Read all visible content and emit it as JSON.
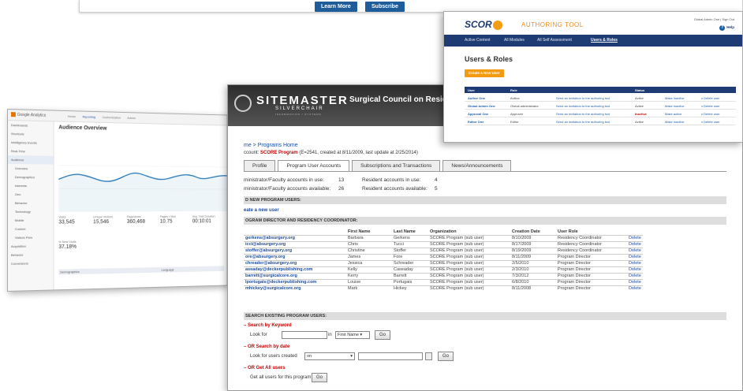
{
  "banner": {
    "learn_more": "Learn More",
    "subscribe": "Subscribe"
  },
  "ga": {
    "logo": "Google Analytics",
    "nav": [
      "Home",
      "Reporting",
      "Customization",
      "Admin"
    ],
    "sidebar": [
      "Dashboards",
      "Shortcuts",
      "Intelligence Events",
      "Real-Time",
      "Audience",
      "Overview",
      "Demographics",
      "Interests",
      "Geo",
      "Behavior",
      "Technology",
      "Mobile",
      "Custom",
      "Visitors Flow",
      "Acquisition",
      "Behavior",
      "Conversions"
    ],
    "title": "Audience Overview",
    "stats": [
      {
        "label": "Visits",
        "value": "33,545"
      },
      {
        "label": "Unique Visitors",
        "value": "15,546"
      },
      {
        "label": "Pageviews",
        "value": "360,468"
      },
      {
        "label": "Pages / Visit",
        "value": "10.75"
      },
      {
        "label": "Avg. Visit Duration",
        "value": "00:10:01"
      }
    ],
    "bounce": {
      "label": "% New Visits",
      "value": "37.18%"
    },
    "table_headers": [
      "Demographics",
      "Language"
    ]
  },
  "sitemaster": {
    "logo": "SITEMASTER",
    "sub": "SILVERCHAIR",
    "tiny": "INFORMATION / SYSTEMS",
    "title": "Surgical Council on Resid",
    "breadcrumb": "me > Programs Home",
    "account_prefix": "ccount:",
    "account_name": "SCORE Program",
    "account_rest": "(E=2541, created at 8/11/2009, last update at 2/25/2014)",
    "tabs": [
      "Profile",
      "Program User Accounts",
      "Subscriptions and Transactions",
      "News/Announcements"
    ],
    "counts": {
      "admin_label": "ministrator/Faculty accounts in use:",
      "admin_value": "13",
      "resident_label": "Resident accounts in use:",
      "resident_value": "4",
      "admin_avail_label": "ministrator/Faculty accounts available:",
      "admin_avail_value": "26",
      "resident_avail_label": "Resident accounts available:",
      "resident_avail_value": "5"
    },
    "sect_new": "D NEW PROGRAM USERS:",
    "create_link": "eate a new user",
    "sect_dir": "OGRAM DIRECTOR AND RESIDENCY COORDINATOR:",
    "columns": [
      "",
      "First Name",
      "Last Name",
      "Organization",
      "Creation Date",
      "User Role",
      ""
    ],
    "users": [
      {
        "email": "gerkens@absurgery.org",
        "first": "Barbara",
        "last": "Gerkens",
        "org": "SCORE Program (sub user)",
        "date": "8/10/2009",
        "role": "Residency Coordinator",
        "action": "Delete"
      },
      {
        "email": "icci@absurgery.org",
        "first": "Chris",
        "last": "Tucci",
        "org": "SCORE Program (sub user)",
        "date": "8/17/2009",
        "role": "Residency Coordinator",
        "action": "Delete"
      },
      {
        "email": "stoffer@absurgery.org",
        "first": "Christine",
        "last": "Stoffer",
        "org": "SCORE Program (sub user)",
        "date": "8/19/2009",
        "role": "Residency Coordinator",
        "action": "Delete"
      },
      {
        "email": "ore@absurgery.org",
        "first": "James",
        "last": "Fore",
        "org": "SCORE Program (sub user)",
        "date": "8/11/2009",
        "role": "Program Director",
        "action": "Delete"
      },
      {
        "email": "chreader@absurgery.org",
        "first": "Jessica",
        "last": "Schreader",
        "org": "SCORE Program (sub user)",
        "date": "2/5/2010",
        "role": "Program Director",
        "action": "Delete"
      },
      {
        "email": "aseaday@deckerpublishing.com",
        "first": "Kelly",
        "last": "Caseaday",
        "org": "SCORE Program (sub user)",
        "date": "2/3/2010",
        "role": "Program Director",
        "action": "Delete"
      },
      {
        "email": "barrett@surgicalcore.org",
        "first": "Kerry",
        "last": "Barrett",
        "org": "SCORE Program (sub user)",
        "date": "7/3/2012",
        "role": "Program Director",
        "action": "Delete"
      },
      {
        "email": "lportugais@deckerpublishing.com",
        "first": "Louise",
        "last": "Portugais",
        "org": "SCORE Program (sub user)",
        "date": "6/8/2010",
        "role": "Program Director",
        "action": "Delete"
      },
      {
        "email": "mhickey@surgicalcore.org",
        "first": "Mark",
        "last": "Hickey",
        "org": "SCORE Program (sub user)",
        "date": "8/11/2008",
        "role": "Program Director",
        "action": "Delete"
      }
    ],
    "sect_search": "SEARCH EXISTING PROGRAM USERS:",
    "search_keyword": "– Search by Keyword",
    "look_for": "Look for",
    "in": "in",
    "field_select": "First Name",
    "go": "Go",
    "search_date": "– OR Search by date",
    "look_created": "Look for users created",
    "date_op": "on",
    "get_all": "– OR Get All users",
    "get_all_label": "Get all users for this program"
  },
  "score": {
    "logo_left": "SCOR",
    "logo_right": "",
    "tool": "AUTHORING TOOL",
    "user": "Global Admin One | Sign Out",
    "help": "Help",
    "nav": [
      "Active Content",
      "All Modules",
      "All Self Assessment",
      "Users & Roles"
    ],
    "heading": "Users & Roles",
    "create_btn": "Create a New User",
    "cols": [
      "User",
      "Role",
      "",
      "Status",
      "",
      ""
    ],
    "rows": [
      {
        "user": "Author One",
        "role": "Author",
        "invite": "Send an invitation to the authoring tool",
        "status": "Active",
        "toggle": "Make inactive",
        "del": "x Delete user",
        "inactive": false
      },
      {
        "user": "Global Admin One",
        "role": "Global administrator",
        "invite": "Send an invitation to the authoring tool",
        "status": "Active",
        "toggle": "Make inactive",
        "del": "x Delete user",
        "inactive": false
      },
      {
        "user": "Approval One",
        "role": "Approver",
        "invite": "Send an invitation to the authoring tool",
        "status": "Inactive",
        "toggle": "Make active",
        "del": "x Delete user",
        "inactive": true
      },
      {
        "user": "Editor One",
        "role": "Editor",
        "invite": "Send an invitation to the authoring tool",
        "status": "Active",
        "toggle": "Make inactive",
        "del": "x Delete user",
        "inactive": false
      }
    ]
  }
}
